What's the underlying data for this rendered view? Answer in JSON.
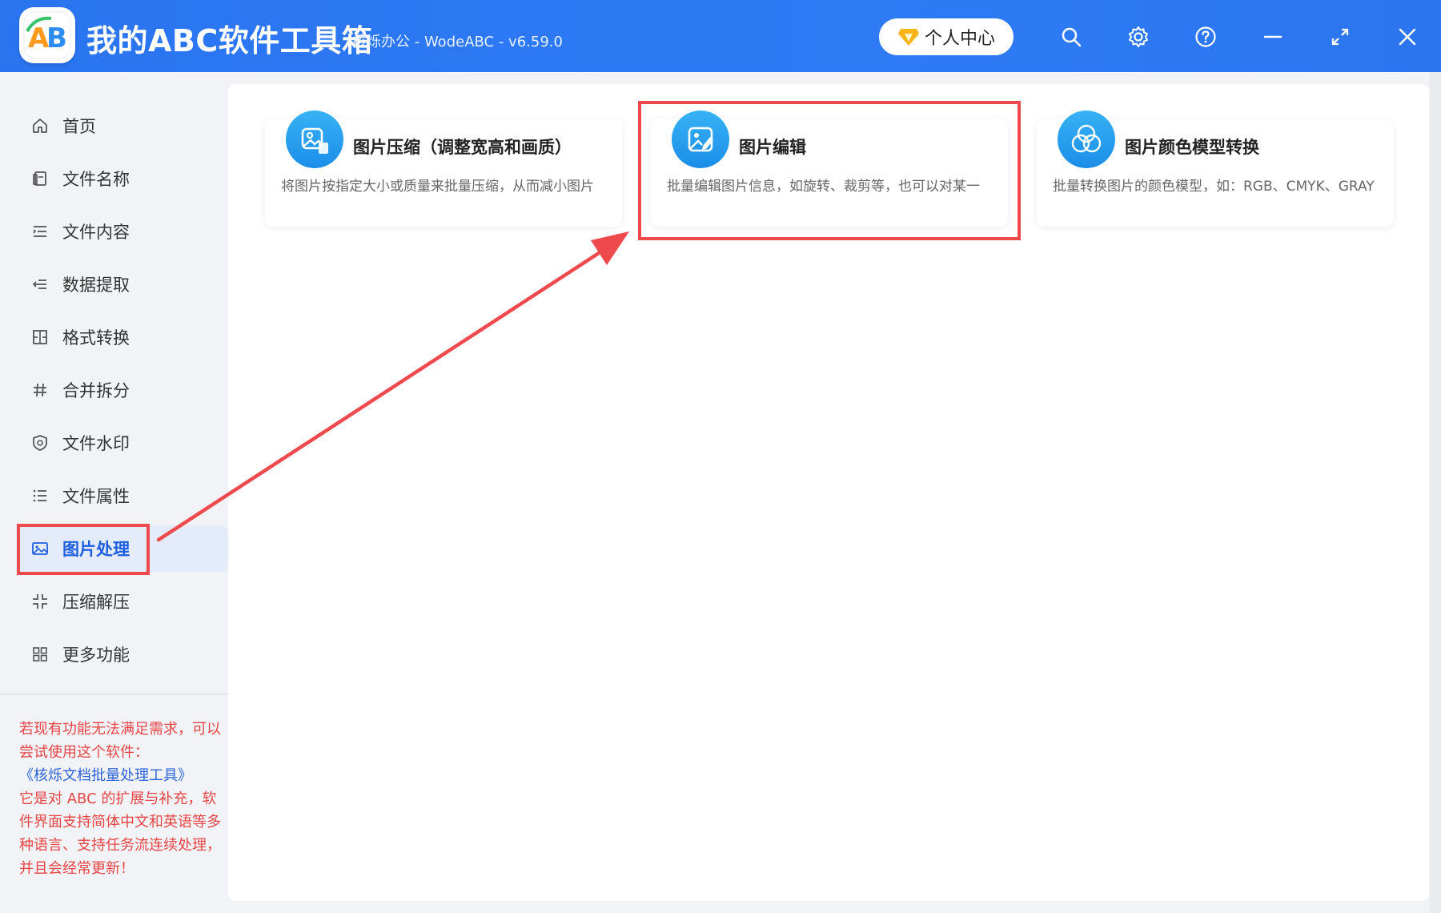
{
  "app": {
    "title": "我的ABC软件工具箱",
    "subtitle": "核烁办公 - WodeABC - v6.59.0",
    "logo_text": "AB",
    "user_center_label": "个人中心"
  },
  "toolbar_icons": [
    "search-icon",
    "settings-icon",
    "help-icon",
    "minimize-icon",
    "maximize-icon",
    "close-icon"
  ],
  "sidebar": {
    "items": [
      {
        "label": "首页",
        "icon": "home-icon"
      },
      {
        "label": "文件名称",
        "icon": "file-name-icon"
      },
      {
        "label": "文件内容",
        "icon": "file-content-icon"
      },
      {
        "label": "数据提取",
        "icon": "data-extract-icon"
      },
      {
        "label": "格式转换",
        "icon": "format-convert-icon"
      },
      {
        "label": "合并拆分",
        "icon": "merge-split-icon"
      },
      {
        "label": "文件水印",
        "icon": "watermark-icon"
      },
      {
        "label": "文件属性",
        "icon": "properties-icon"
      },
      {
        "label": "图片处理",
        "icon": "image-icon",
        "active": true
      },
      {
        "label": "压缩解压",
        "icon": "compress-icon"
      },
      {
        "label": "更多功能",
        "icon": "more-icon"
      }
    ],
    "note": {
      "line1": "若现有功能无法满足需求，可以尝试使用这个软件：",
      "link": "《核烁文档批量处理工具》",
      "line2": "它是对 ABC 的扩展与补充，软件界面支持简体中文和英语等多种语言、支持任务流连续处理，并且会经常更新！"
    }
  },
  "cards": [
    {
      "title": "图片压缩（调整宽高和画质）",
      "desc": "将图片按指定大小或质量来批量压缩，从而减小图片",
      "icon": "image-compress-icon"
    },
    {
      "title": "图片编辑",
      "desc": "批量编辑图片信息，如旋转、裁剪等，也可以对某一",
      "icon": "image-edit-icon",
      "highlighted": true
    },
    {
      "title": "图片颜色模型转换",
      "desc": "批量转换图片的颜色模型，如：RGB、CMYK、GRAY",
      "icon": "color-model-icon"
    }
  ],
  "colors": {
    "titlebar": "#2f7bf6",
    "active_text": "#1e5fe0",
    "highlight_frame": "#ee4a4e",
    "note_text": "#e54545",
    "link_text": "#2c64d8"
  }
}
